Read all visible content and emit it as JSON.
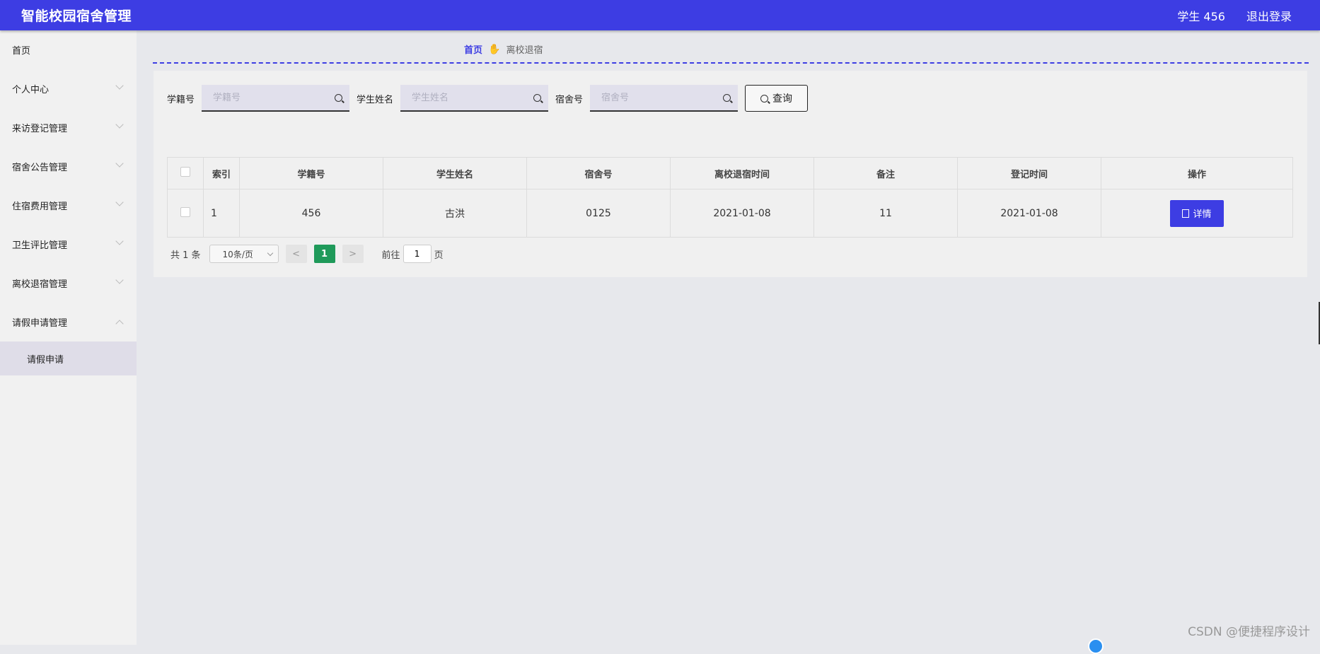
{
  "app": {
    "title": "智能校园宿舍管理"
  },
  "header": {
    "user": "学生 456",
    "logout": "退出登录"
  },
  "sidebar": {
    "items": [
      {
        "label": "首页",
        "expandable": false
      },
      {
        "label": "个人中心",
        "expandable": true
      },
      {
        "label": "来访登记管理",
        "expandable": true
      },
      {
        "label": "宿舍公告管理",
        "expandable": true
      },
      {
        "label": "住宿费用管理",
        "expandable": true
      },
      {
        "label": "卫生评比管理",
        "expandable": true
      },
      {
        "label": "离校退宿管理",
        "expandable": true
      },
      {
        "label": "请假申请管理",
        "expandable": true,
        "expanded": true
      }
    ],
    "subitem": "请假申请"
  },
  "breadcrumb": {
    "home": "首页",
    "separator_icon": "hand-icon",
    "current": "离校退宿"
  },
  "search": {
    "student_id_label": "学籍号",
    "student_id_placeholder": "学籍号",
    "name_label": "学生姓名",
    "name_placeholder": "学生姓名",
    "dorm_label": "宿舍号",
    "dorm_placeholder": "宿舍号",
    "query_label": "查询"
  },
  "table": {
    "headers": [
      "索引",
      "学籍号",
      "学生姓名",
      "宿舍号",
      "离校退宿时间",
      "备注",
      "登记时间",
      "操作"
    ],
    "rows": [
      {
        "index": "1",
        "student_id": "456",
        "name": "古洪",
        "dorm": "0125",
        "leave_time": "2021-01-08",
        "note": "11",
        "reg_time": "2021-01-08",
        "action": "详情"
      }
    ]
  },
  "pagination": {
    "total": "共 1 条",
    "page_size": "10条/页",
    "prev": "<",
    "current_page": "1",
    "next": ">",
    "goto_prefix": "前往",
    "goto_value": "1",
    "goto_suffix": "页"
  },
  "watermark": "CSDN @便捷程序设计",
  "colors": {
    "primary": "#3d3de3",
    "page_active": "#1f9a5a"
  }
}
